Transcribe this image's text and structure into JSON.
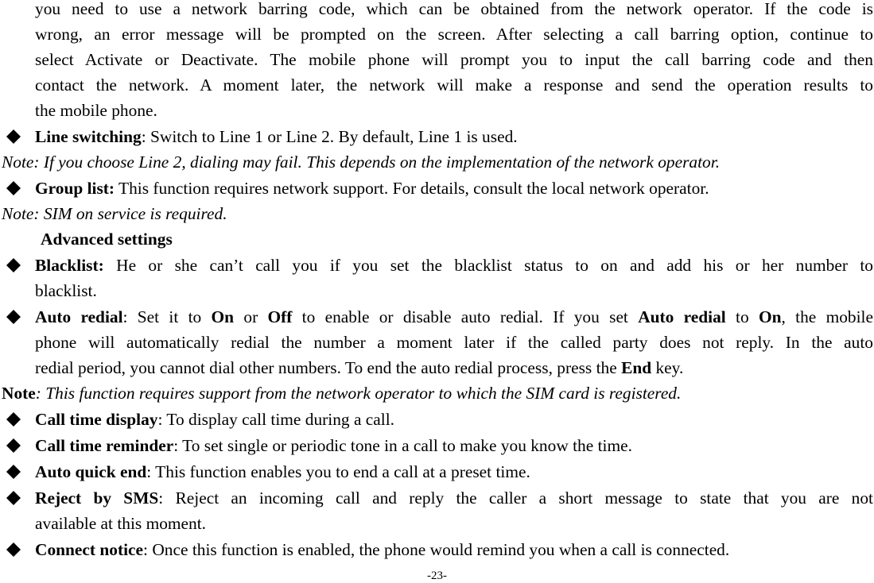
{
  "intro_lines": [
    "you need to use a network barring code, which can be obtained from the network operator. If the code is",
    "wrong, an error message will be prompted on the screen. After selecting a call barring option, continue to",
    "select Activate or Deactivate. The mobile phone will prompt you to input the call barring code and then",
    "contact the network. A moment later, the network will make a response and send the operation results to",
    "the mobile phone."
  ],
  "line_switching": {
    "term": "Line switching",
    "text": ": Switch to Line 1 or Line 2. By default, Line 1 is used.",
    "note": "Note: If you choose Line 2, dialing may fail. This depends on the implementation of the network operator."
  },
  "group_list": {
    "term": "Group list:",
    "text": " This function requires network support. For details, consult the local network operator.",
    "note": "Note: SIM on service is required."
  },
  "advanced_heading": "Advanced settings",
  "blacklist": {
    "term": "Blacklist:",
    "text_line1": " He or she can’t call you if you set the blacklist status to on and add his or her number to",
    "text_line2": "blacklist."
  },
  "auto_redial": {
    "term": "Auto redial",
    "p1": ": Set it to ",
    "on1": "On",
    "p2": " or ",
    "off": "Off",
    "p3": " to enable or disable auto redial. If you set ",
    "term2": "Auto redial",
    "p4": " to ",
    "on2": "On",
    "p5": ", the mobile",
    "line2": "phone will automatically redial the number a moment later if the called party does not reply. In the auto",
    "line3_a": "redial period, you cannot dial other numbers. To end the auto redial process, press the ",
    "end_key": "End",
    "line3_b": " key.",
    "note_label": "Note",
    "note_text": ": This function requires support from the network operator to which the SIM card is registered."
  },
  "call_time_display": {
    "term": "Call time display",
    "text": ": To display call time during a call."
  },
  "call_time_reminder": {
    "term": "Call time reminder",
    "text": ": To set single or periodic tone in a call to make you know the time."
  },
  "auto_quick_end": {
    "term": "Auto quick end",
    "text": ": This function enables you to end a call at a preset time."
  },
  "reject_by_sms": {
    "term": "Reject by SMS",
    "text_line1": ": Reject an incoming call and reply the caller a short message to state that you are not",
    "text_line2": "available at this moment."
  },
  "connect_notice": {
    "term": "Connect notice",
    "text": ": Once this function is enabled, the phone would remind you when a call is connected."
  },
  "bullet_icon": "black-diamond",
  "page_number": "-23-"
}
